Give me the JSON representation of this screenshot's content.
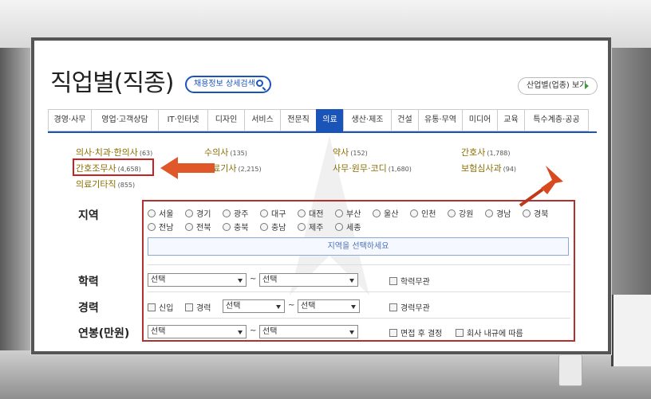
{
  "header": {
    "title": "직업별(직종)",
    "detail_search": "채용정보 상세검색",
    "industry_view": "산업별(업종) 보기"
  },
  "tabs": [
    "경영·사무",
    "영업·고객상담",
    "IT·인터넷",
    "디자인",
    "서비스",
    "전문직",
    "의료",
    "생산·제조",
    "건설",
    "유통·무역",
    "미디어",
    "교육",
    "특수계층·공공"
  ],
  "occupations": [
    {
      "name": "의사·치과·한의사",
      "count": "(63)"
    },
    {
      "name": "수의사",
      "count": "(135)"
    },
    {
      "name": "약사",
      "count": "(152)"
    },
    {
      "name": "간호사",
      "count": "(1,788)"
    },
    {
      "name": "간호조무사",
      "count": "(4,658)"
    },
    {
      "name": "의료기사",
      "count": "(2,215)"
    },
    {
      "name": "사무·원무·코디",
      "count": "(1,680)"
    },
    {
      "name": "보험심사과",
      "count": "(94)"
    },
    {
      "name": "의료기타직",
      "count": "(855)"
    }
  ],
  "filters": {
    "region_label": "지역",
    "regions": [
      "서울",
      "경기",
      "광주",
      "대구",
      "대전",
      "부산",
      "울산",
      "인천",
      "강원",
      "경남",
      "경북",
      "전남",
      "전북",
      "충북",
      "충남",
      "제주",
      "세종"
    ],
    "region_placeholder": "지역을 선택하세요",
    "education_label": "학력",
    "career_label": "경력",
    "salary_label": "연봉(만원)",
    "select_text": "선택",
    "tilde": "~",
    "education_any": "학력무관",
    "newcomer": "신입",
    "experienced": "경력",
    "career_any": "경력무관",
    "after_interview": "면접 후 결정",
    "company_policy": "회사 내규에 따름"
  },
  "colors": {
    "accent": "#1a54b8",
    "highlight": "#cc1f1f",
    "arrow": "#e0572a"
  }
}
